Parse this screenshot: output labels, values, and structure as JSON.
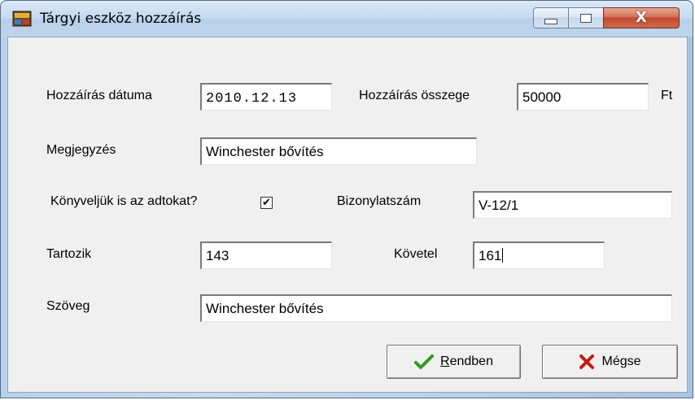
{
  "window": {
    "title": "Tárgyi eszköz hozzáírás",
    "controls": {
      "minimize": "minimize",
      "maximize": "maximize",
      "close": "close"
    }
  },
  "form": {
    "date_label": "Hozzáírás dátuma",
    "date_value": "2010.12.13",
    "amount_label": "Hozzáírás összege",
    "amount_value": "50000",
    "currency": "Ft",
    "note_label": "Megjegyzés",
    "note_value": "Winchester bővítés",
    "book_tax_label": "Könyveljük is az adtokat?",
    "book_tax_checked": true,
    "voucher_label": "Bizonylatszám",
    "voucher_value": "V-12/1",
    "debit_label": "Tartozik",
    "debit_value": "143",
    "credit_label": "Követel",
    "credit_value": "161",
    "text_label": "Szöveg",
    "text_value": "Winchester bővítés"
  },
  "buttons": {
    "ok_first": "R",
    "ok_rest": "endben",
    "cancel": "Mégse"
  },
  "colors": {
    "titlebar": "#c4d8ef",
    "close_button": "#c04a2f",
    "client": "#f0f0f0",
    "ok_icon": "#2e9a1e",
    "cancel_icon": "#c41a12"
  },
  "icons": {
    "app": "app-icon",
    "ok": "checkmark-icon",
    "cancel": "x-icon"
  }
}
